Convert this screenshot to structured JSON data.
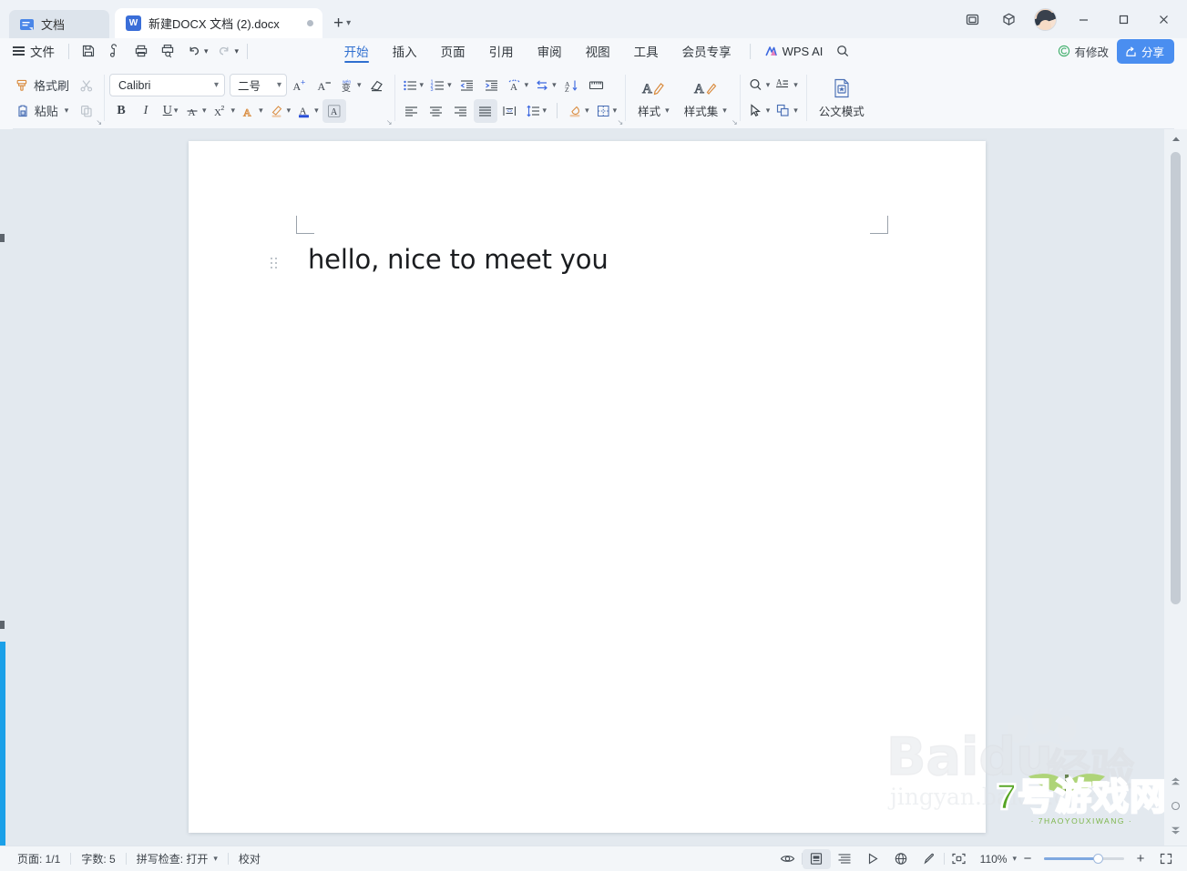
{
  "titlebar": {
    "docs_chip_label": "文档",
    "tab": {
      "label": "新建DOCX 文档 (2).docx",
      "icon_letter": "W"
    },
    "new_tab_label": "+",
    "window_buttons": [
      "minimize",
      "maximize",
      "close"
    ]
  },
  "menubar": {
    "file_label": "文件",
    "quick_access": [
      "save-icon",
      "save-as-icon",
      "print-icon",
      "print-preview-icon",
      "undo-icon",
      "redo-icon",
      "customize-qat-icon"
    ],
    "tabs": [
      {
        "label": "开始",
        "active": true
      },
      {
        "label": "插入",
        "active": false
      },
      {
        "label": "页面",
        "active": false
      },
      {
        "label": "引用",
        "active": false
      },
      {
        "label": "审阅",
        "active": false
      },
      {
        "label": "视图",
        "active": false
      },
      {
        "label": "工具",
        "active": false
      },
      {
        "label": "会员专享",
        "active": false
      }
    ],
    "wps_ai_label": "WPS AI",
    "search_icon": "search-icon",
    "modified_label": "有修改",
    "share_label": "分享"
  },
  "ribbon": {
    "clipboard": {
      "format_painter_label": "格式刷",
      "paste_label": "粘贴",
      "cut_label": "剪切",
      "copy_label": "复制"
    },
    "font": {
      "font_family_value": "Calibri",
      "font_size_value": "二号",
      "grow_font": "A+",
      "shrink_font": "A-",
      "bold": "B",
      "italic": "I",
      "underline": "U",
      "strikethrough": "abc",
      "superscript": "X²",
      "text_effects": "A",
      "highlight": "A",
      "font_color": "A",
      "char_shading": "A"
    },
    "paragraph": {
      "bullets": "bullet-list-icon",
      "numbering": "numbered-list-icon",
      "decrease_indent": "decrease-indent-icon",
      "increase_indent": "increase-indent-icon",
      "asian_layout": "asian-layout-icon",
      "ltr_rtl": "text-direction-icon",
      "sort": "sort-icon",
      "show_marks": "show-paragraph-marks-icon",
      "align_left": "align-left-icon",
      "align_center": "align-center-icon",
      "align_right": "align-right-icon",
      "align_justify": "align-justify-icon",
      "distribute": "distributed-align-icon",
      "line_spacing": "line-spacing-icon",
      "shading": "shading-icon",
      "borders": "borders-icon"
    },
    "styles": {
      "styles_label": "样式",
      "style_set_label": "样式集"
    },
    "editing": {
      "find_label": "find-icon",
      "select_label": "select-object-icon",
      "text_tools_label": "text-tools-icon",
      "arrange_label": "arrange-objects-icon"
    },
    "doc_mode": {
      "label": "公文模式"
    }
  },
  "document": {
    "body_text": "hello, nice to meet you",
    "page_corner_marks": true
  },
  "watermarks": {
    "baidu_main": "Baidu",
    "baidu_cn": "经验",
    "baidu_sub": "jingyan.baidu.com",
    "site_main": "7号游戏网",
    "site_sub": "· 7HAOYOUXIWANG ·"
  },
  "statusbar": {
    "page_label": "页面: 1/1",
    "word_count_label": "字数: 5",
    "spellcheck_label": "拼写检查: 打开",
    "proofread_label": "校对",
    "view_icons": [
      "preview-eye-icon",
      "print-layout-icon",
      "outline-view-icon",
      "web-layout-icon",
      "reading-view-icon",
      "pen-icon",
      "focus-mode-icon"
    ],
    "zoom_value": "110%",
    "zoom_minus": "−",
    "zoom_plus": "+",
    "fullscreen_icon": "fullscreen-icon"
  },
  "colors": {
    "accent_blue": "#2f6fd0",
    "share_blue": "#4a8ef0",
    "left_accent": "#1ba0e8",
    "workspace_bg": "#e3e9ef",
    "page_white": "#ffffff"
  }
}
